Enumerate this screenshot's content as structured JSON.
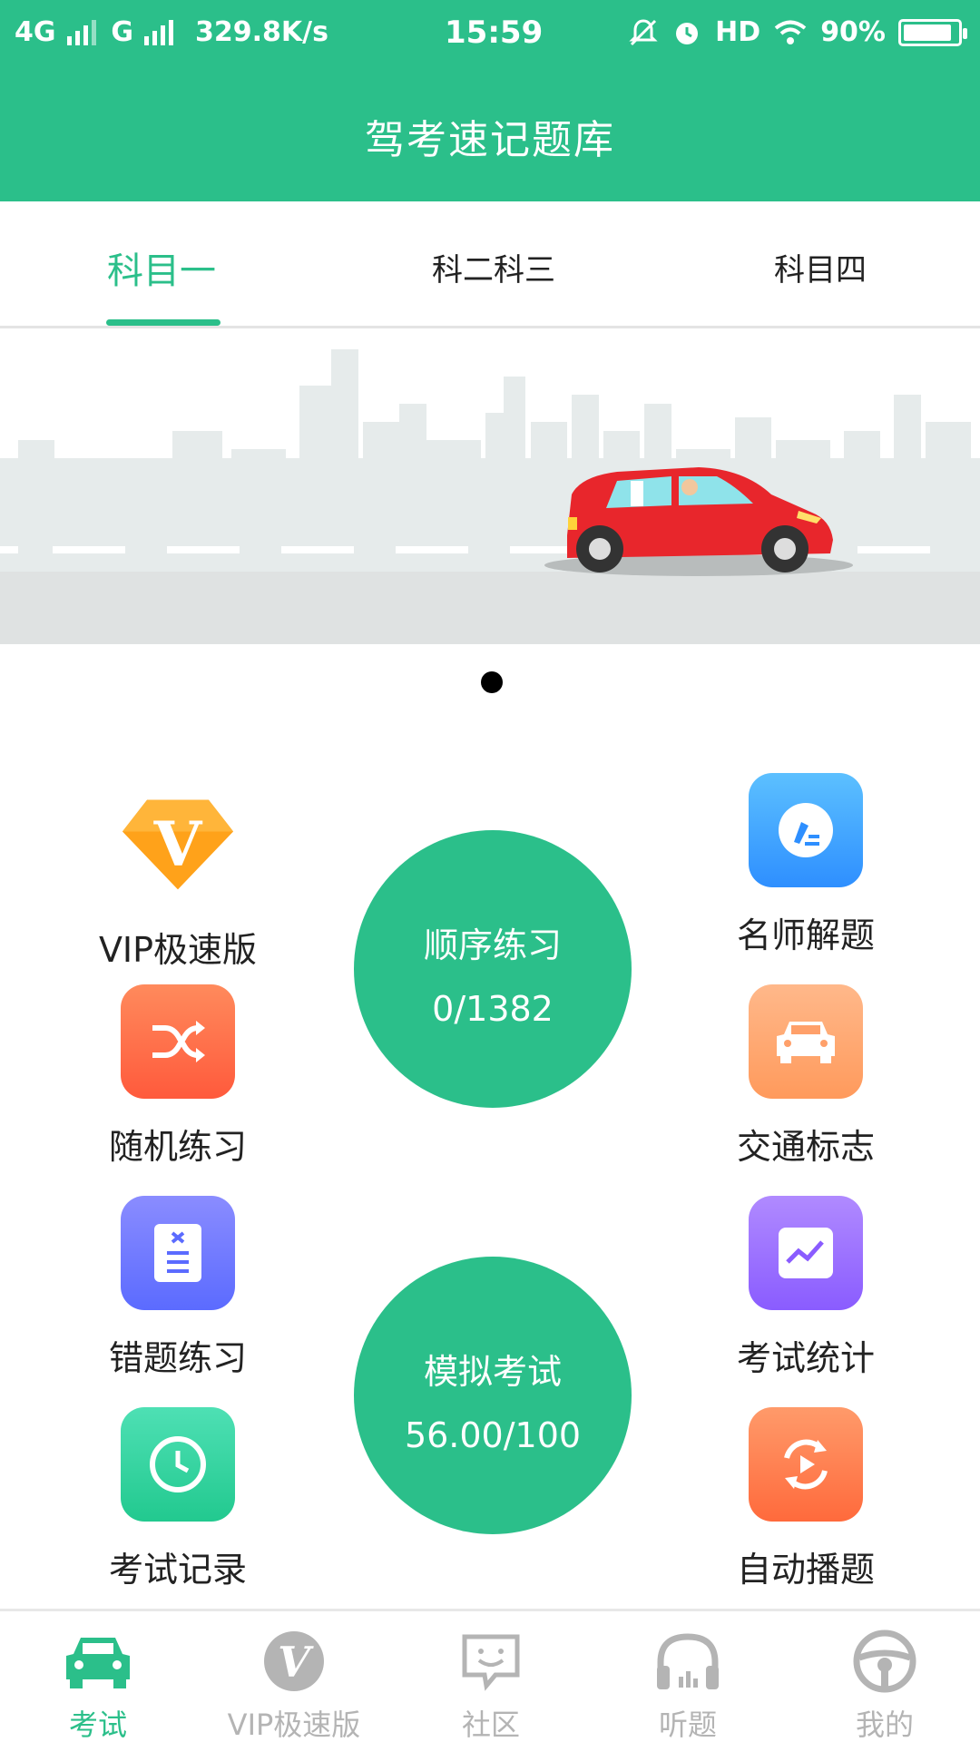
{
  "status_bar": {
    "network": "4G",
    "network2": "G",
    "speed": "329.8K/s",
    "time": "15:59",
    "hd": "HD",
    "battery": "90%",
    "battery_level": 0.9
  },
  "header": {
    "title": "驾考速记题库"
  },
  "tabs": [
    {
      "label": "科目一",
      "active": true
    },
    {
      "label": "科二科三",
      "active": false
    },
    {
      "label": "科目四",
      "active": false
    }
  ],
  "banner": {
    "page_indicator_count": 1,
    "current_page": 1
  },
  "features_left": [
    {
      "label": "VIP极速版",
      "icon": "vip-diamond-icon",
      "color": "#ffa21a"
    },
    {
      "label": "随机练习",
      "icon": "shuffle-icon",
      "color": "#ff6a4a"
    },
    {
      "label": "错题练习",
      "icon": "wrong-list-icon",
      "color": "#6e78ff"
    },
    {
      "label": "考试记录",
      "icon": "clock-icon",
      "color": "#2fd6a0"
    }
  ],
  "features_right": [
    {
      "label": "名师解题",
      "icon": "pen-icon",
      "color": "#3aa6ff"
    },
    {
      "label": "交通标志",
      "icon": "car-icon",
      "color": "#ffa06a"
    },
    {
      "label": "考试统计",
      "icon": "chart-icon",
      "color": "#9b6dff"
    },
    {
      "label": "自动播题",
      "icon": "autoplay-icon",
      "color": "#ff7a4a"
    }
  ],
  "sequence_practice": {
    "title": "顺序练习",
    "progress": "0/1382"
  },
  "mock_exam": {
    "title": "模拟考试",
    "score": "56.00/100"
  },
  "bottom_nav": [
    {
      "label": "考试",
      "icon": "car-icon",
      "active": true
    },
    {
      "label": "VIP极速版",
      "icon": "vip-icon",
      "active": false
    },
    {
      "label": "社区",
      "icon": "community-icon",
      "active": false
    },
    {
      "label": "听题",
      "icon": "headphones-icon",
      "active": false
    },
    {
      "label": "我的",
      "icon": "steering-wheel-icon",
      "active": false
    }
  ],
  "colors": {
    "primary": "#2bbf8a",
    "inactive": "#b4b4b4"
  }
}
